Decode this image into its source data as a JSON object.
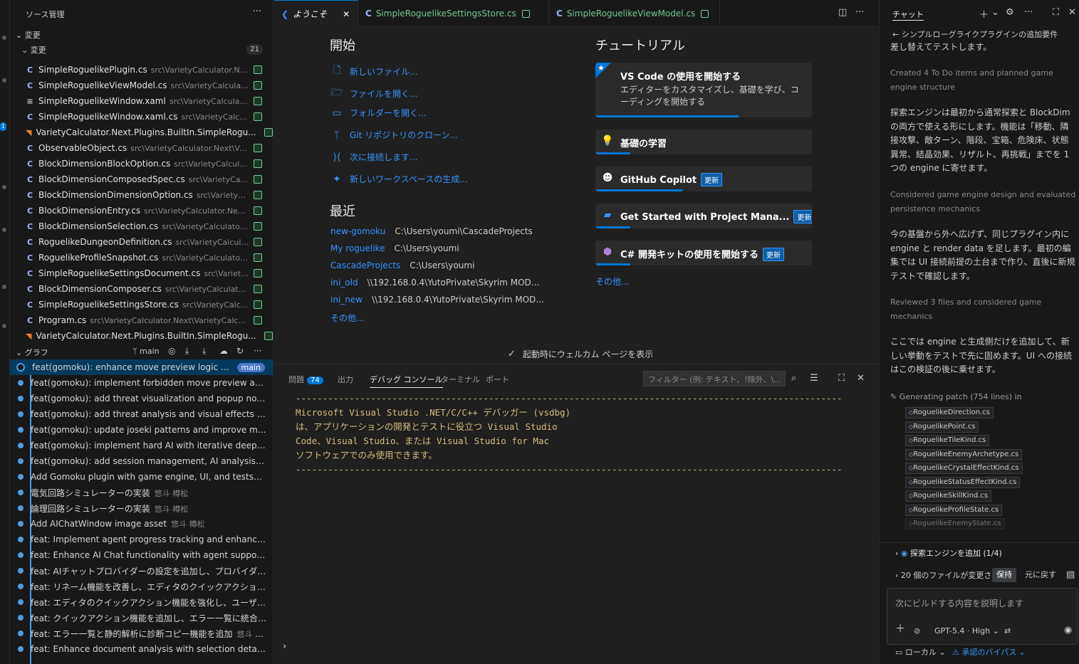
{
  "sidebar": {
    "title": "ソース管理",
    "changes_section": "変更",
    "changes_sub": "変更",
    "changes_count": "21",
    "files": [
      {
        "name": "SimpleRoguelikePlugin.cs",
        "path": "src\\VarietyCalculator.Next...",
        "icon": "csharp-icon"
      },
      {
        "name": "SimpleRoguelikeViewModel.cs",
        "path": "src\\VarietyCalculator...",
        "icon": "csharp-icon"
      },
      {
        "name": "SimpleRoguelikeWindow.xaml",
        "path": "src\\VarietyCalculator...",
        "icon": "xaml-icon"
      },
      {
        "name": "SimpleRoguelikeWindow.xaml.cs",
        "path": "src\\VarietyCalcula...",
        "icon": "csharp-icon"
      },
      {
        "name": "VarietyCalculator.Next.Plugins.BuiltIn.SimpleRogu...",
        "path": "",
        "icon": "rss-icon"
      },
      {
        "name": "ObservableObject.cs",
        "path": "src\\VarietyCalculator.Next\\Varie...",
        "icon": "csharp-icon"
      },
      {
        "name": "BlockDimensionBlockOption.cs",
        "path": "src\\VarietyCalculato...",
        "icon": "csharp-icon"
      },
      {
        "name": "BlockDimensionComposedSpec.cs",
        "path": "src\\VarietyCalcu...",
        "icon": "csharp-icon"
      },
      {
        "name": "BlockDimensionDimensionOption.cs",
        "path": "src\\VarietyCal...",
        "icon": "csharp-icon"
      },
      {
        "name": "BlockDimensionEntry.cs",
        "path": "src\\VarietyCalculator.Next\\V...",
        "icon": "csharp-icon"
      },
      {
        "name": "BlockDimensionSelection.cs",
        "path": "src\\VarietyCalculator.N...",
        "icon": "csharp-icon"
      },
      {
        "name": "RoguelikeDungeonDefinition.cs",
        "path": "src\\VarietyCalculat...",
        "icon": "csharp-icon"
      },
      {
        "name": "RoguelikeProfileSnapshot.cs",
        "path": "src\\VarietyCalculator.N...",
        "icon": "csharp-icon"
      },
      {
        "name": "SimpleRoguelikeSettingsDocument.cs",
        "path": "src\\VarietyC...",
        "icon": "csharp-icon"
      },
      {
        "name": "BlockDimensionComposer.cs",
        "path": "src\\VarietyCalculator...",
        "icon": "csharp-icon"
      },
      {
        "name": "SimpleRoguelikeSettingsStore.cs",
        "path": "src\\VarietyCalcula...",
        "icon": "csharp-icon"
      },
      {
        "name": "Program.cs",
        "path": "src\\VarietyCalculator.Next\\VarietyCalculat...",
        "icon": "csharp-icon"
      },
      {
        "name": "VarietyCalculator.Next.Plugins.BuiltIn.SimpleRogu...",
        "path": "",
        "icon": "rss-icon"
      }
    ],
    "graph_section": "グラフ",
    "graph_branch": "main",
    "commits": [
      {
        "msg": "feat(gomoku): enhance move preview logic an...",
        "author": "",
        "head": true
      },
      {
        "msg": "feat(gomoku): implement forbidden move preview and ...",
        "author": ""
      },
      {
        "msg": "feat(gomoku): add threat visualization and popup notifi...",
        "author": ""
      },
      {
        "msg": "feat(gomoku): add threat analysis and visual effects for ...",
        "author": ""
      },
      {
        "msg": "feat(gomoku): update joseki patterns and improve matc...",
        "author": ""
      },
      {
        "msg": "feat(gomoku): implement hard AI with iterative deepeni...",
        "author": ""
      },
      {
        "msg": "feat(gomoku): add session management, AI analysis, an...",
        "author": ""
      },
      {
        "msg": "Add Gomoku plugin with game engine, UI, and tests",
        "author": "悠..."
      },
      {
        "msg": "電気回路シミュレーターの実装",
        "author": "悠斗 樽松"
      },
      {
        "msg": "論理回路シミュレーターの実装",
        "author": "悠斗 樽松"
      },
      {
        "msg": "Add AIChatWindow image asset",
        "author": "悠斗 樽松"
      },
      {
        "msg": "feat: Implement agent progress tracking and enhance A...",
        "author": ""
      },
      {
        "msg": "feat: Enhance AI Chat functionality with agent support a...",
        "author": ""
      },
      {
        "msg": "feat: AIチャットプロバイダーの設定を追加し、プロバイダーのファク...",
        "author": ""
      },
      {
        "msg": "feat: リネーム機能を改善し、エディタのクイックアクションを強化...",
        "author": ""
      },
      {
        "msg": "feat: エディタのクイックアクション機能を強化し、ユーザー入力を...",
        "author": ""
      },
      {
        "msg": "feat: クイックアクション機能を追加し、エラー一覧に統合",
        "author": "悠斗 ..."
      },
      {
        "msg": "feat: エラー一覧と静的解析に診断コピー機能を追加",
        "author": "悠斗 樽松"
      },
      {
        "msg": "feat: Enhance document analysis with selection details a...",
        "author": ""
      }
    ]
  },
  "tabs": [
    {
      "label": "ようこそ",
      "active": true
    },
    {
      "label": "SimpleRoguelikeSettingsStore.cs"
    },
    {
      "label": "SimpleRoguelikeViewModel.cs"
    }
  ],
  "welcome": {
    "start_title": "開始",
    "start_links": [
      {
        "label": "新しいファイル...",
        "icon": "new-file-icon"
      },
      {
        "label": "ファイルを開く...",
        "icon": "open-file-icon"
      },
      {
        "label": "フォルダーを開く...",
        "icon": "folder-icon"
      },
      {
        "label": "Git リポジトリのクローン...",
        "icon": "git-icon"
      },
      {
        "label": "次に接続します...",
        "icon": "remote-icon"
      },
      {
        "label": "新しいワークスペースの生成...",
        "icon": "workspace-icon"
      }
    ],
    "recent_title": "最近",
    "recent": [
      {
        "name": "new-gomoku",
        "path": "C:\\Users\\youmi\\CascadeProjects"
      },
      {
        "name": "My roguelike",
        "path": "C:\\Users\\youmi"
      },
      {
        "name": "CascadeProjects",
        "path": "C:\\Users\\youmi"
      },
      {
        "name": "ini_old",
        "path": "\\\\192.168.0.4\\YutoPrivate\\Skyrim MOD..."
      },
      {
        "name": "ini_new",
        "path": "\\\\192.168.0.4\\YutoPrivate\\Skyrim MOD..."
      }
    ],
    "recent_more": "その他...",
    "tutorial_title": "チュートリアル",
    "cards": [
      {
        "title": "VS Code の使用を開始する",
        "desc": "エディターをカスタマイズし、基礎を学び、コーディングを開始する",
        "progress": 0.66
      },
      {
        "title": "基礎の学習",
        "progress": 0.16
      },
      {
        "title": "GitHub Copilot",
        "badge": "更新",
        "progress": 0.4
      },
      {
        "title": "Get Started with Project Mana...",
        "badge": "更新",
        "progress": 0.16
      },
      {
        "title": "C# 開発キットの使用を開始する",
        "badge": "更新",
        "progress": 0.16
      }
    ],
    "tutorial_more": "その他...",
    "show_on_startup": "起動時にウェルカム ページを表示"
  },
  "panel": {
    "tabs": [
      {
        "label": "問題",
        "badge": "74"
      },
      {
        "label": "出力"
      },
      {
        "label": "デバッグ コンソール",
        "active": true
      },
      {
        "label": "ターミナル"
      },
      {
        "label": "ポート"
      }
    ],
    "filter_placeholder": "フィルター (例: テキスト、!除外、\\...",
    "console": "------------------------------------------------------------------------------------------------------\nMicrosoft Visual Studio .NET/C/C++ デバッガー (vsdbg)\nは、アプリケーションの開発とテストに役立つ Visual Studio\nCode、Visual Studio、または Visual Studio for Mac\nソフトウェアでのみ使用できます。\n------------------------------------------------------------------------------------------------------"
  },
  "chat": {
    "title": "チャット",
    "back_title": "シンプルローグライクプラグインの追加要件",
    "intro": "差し替えてテストします。",
    "step1": "Created 4 To Do items and planned game engine structure",
    "para1": "探索エンジンは最初から通常探索と BlockDim の両方で使える形にします。機能は「移動、隣接攻撃、敵ターン、階段、宝箱、危険床、状態異常、結晶効果、リザルト、再挑戦」までを 1 つの engine に寄せます。",
    "step2": "Considered game engine design and evaluated persistence mechanics",
    "para2": "今の基盤から外へ広げず、同じプラグイン内に engine と render data を足します。最初の編集では UI 接続前提の土台まで作り、直後に新規テストで確認します。",
    "step3": "Reviewed 3 files and considered game mechanics",
    "para3": "ここでは engine と生成側だけを追加して、新しい挙動をテストで先に固めます。UI への接続はこの検証の後に乗せます。",
    "generating": "Generating patch (754 lines) in",
    "chips": [
      "RoguelikeDirection.cs",
      "RoguelikePoint.cs",
      "RoguelikeTileKind.cs",
      "RoguelikeEnemyArchetype.cs",
      "RoguelikeCrystalEffectKind.cs",
      "RoguelikeStatusEffectKind.cs",
      "RoguelikeSkillKind.cs",
      "RoguelikeProfileState.cs",
      "RoguelikeEnemyState.cs"
    ],
    "todo": "探索エンジンを追加 (1/4)",
    "changes": "20 個のファイルが変更さ",
    "keep": "保持",
    "undo": "元に戻す",
    "placeholder": "次にビルドする内容を説明します",
    "model": "GPT-5.4 · High",
    "local": "ローカル",
    "approval": "承認のバイパス"
  }
}
